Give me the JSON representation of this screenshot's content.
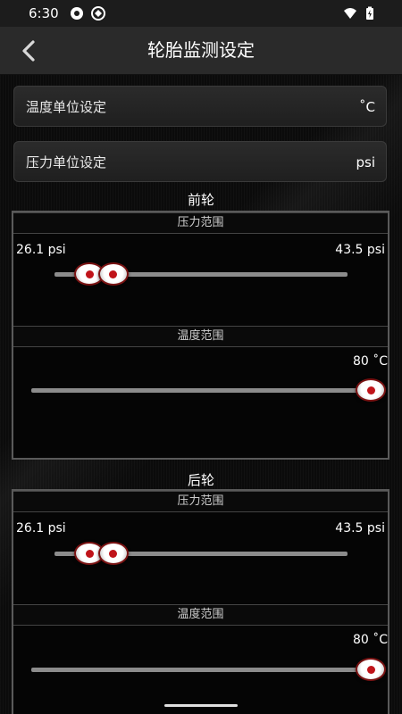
{
  "status_bar": {
    "time": "6:30"
  },
  "header": {
    "title": "轮胎监测设定"
  },
  "settings": {
    "temp_unit": {
      "label": "温度单位设定",
      "value": "˚C"
    },
    "pressure_unit": {
      "label": "压力单位设定",
      "value": "psi"
    }
  },
  "front": {
    "title": "前轮",
    "pressure": {
      "title": "压力范围",
      "min_label": "26.1 psi",
      "max_label": "43.5 psi",
      "low_fraction": 0.12,
      "high_fraction": 0.2
    },
    "temperature": {
      "title": "温度范围",
      "max_label": "80 ˚C",
      "fraction": 1.0
    }
  },
  "rear": {
    "title": "后轮",
    "pressure": {
      "title": "压力范围",
      "min_label": "26.1 psi",
      "max_label": "43.5 psi",
      "low_fraction": 0.12,
      "high_fraction": 0.2
    },
    "temperature": {
      "title": "温度范围",
      "max_label": "80 ˚C",
      "fraction": 1.0
    }
  },
  "colors": {
    "accent": "#c0141a",
    "track": "#8c8c8c"
  }
}
